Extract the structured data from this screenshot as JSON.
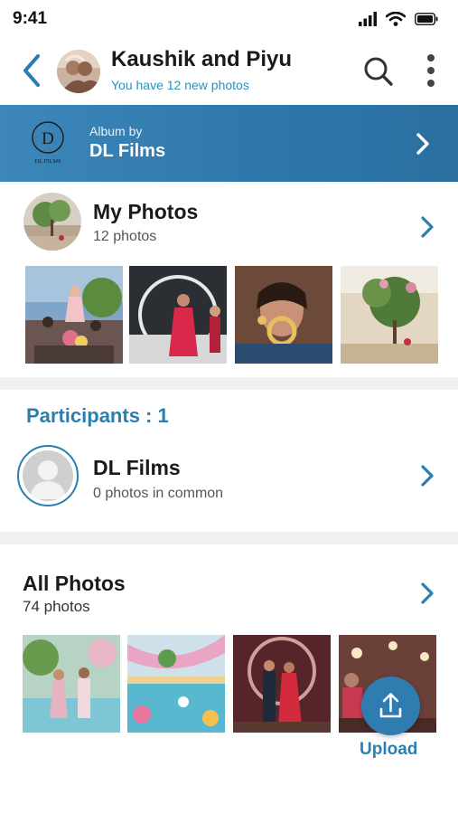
{
  "status_bar": {
    "time": "9:41",
    "icons": [
      "signal-icon",
      "wifi-icon",
      "battery-icon"
    ]
  },
  "header": {
    "title": "Kaushik and Piyu",
    "subtitle": "You have 12 new photos",
    "icons": [
      "back-arrow-icon",
      "search-icon",
      "more-vertical-icon"
    ]
  },
  "album_banner": {
    "label": "Album by",
    "owner": "DL Films",
    "logo_text": "DL FILMS"
  },
  "my_photos": {
    "title": "My Photos",
    "count": "12 photos",
    "thumbnails": [
      "wedding-procession-photo",
      "couple-dance-photo",
      "bride-portrait-photo",
      "garden-bride-photo"
    ]
  },
  "participants": {
    "title": "Participants : 1",
    "items": [
      {
        "name": "DL Films",
        "common": "0 photos in common"
      }
    ]
  },
  "all_photos": {
    "title": "All Photos",
    "count": "74 photos",
    "thumbnails": [
      "poolside-couple-photo",
      "pool-decor-photo",
      "stage-couple-photo",
      "reception-guests-photo"
    ]
  },
  "upload": {
    "label": "Upload"
  },
  "colors": {
    "accent": "#2a7fb0",
    "banner_start": "#3d86b8",
    "banner_end": "#2a6f9f",
    "divider": "#f0f0f0"
  }
}
